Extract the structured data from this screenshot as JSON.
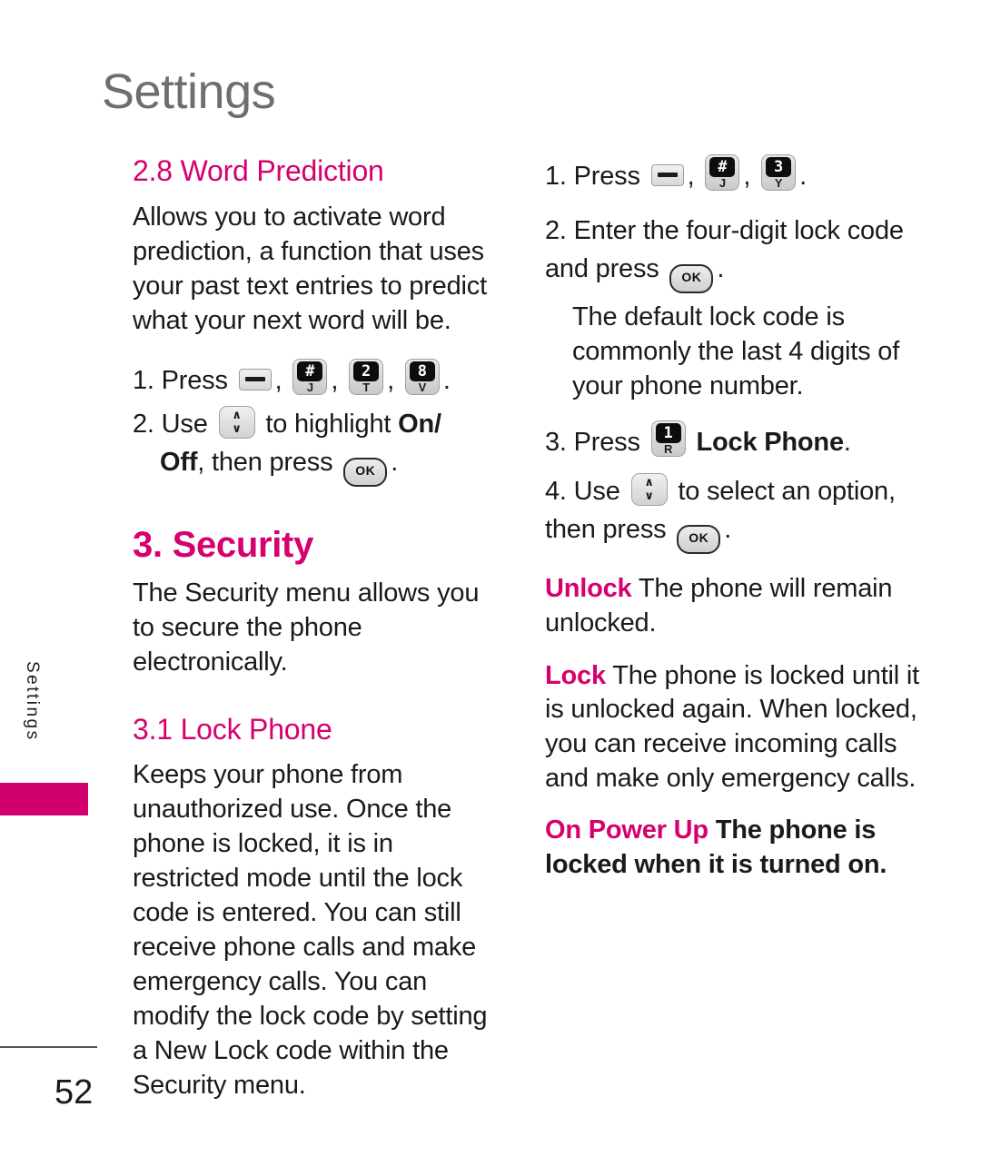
{
  "page": {
    "header_title": "Settings",
    "side_tab_label": "Settings",
    "page_number": "52"
  },
  "colors": {
    "accent_magenta": "#D6006E",
    "tab_magenta": "#D0006F",
    "header_gray": "#6E6E6E",
    "body_black": "#1A1A1A"
  },
  "keys": {
    "menu": {
      "name": "menu-soft-key",
      "label": ""
    },
    "hash_j": {
      "name": "key-hash-j",
      "digit": "#",
      "letter": "J"
    },
    "two_t": {
      "name": "key-2-t",
      "digit": "2",
      "letter": "T"
    },
    "eight_v": {
      "name": "key-8-v",
      "digit": "8",
      "letter": "V"
    },
    "three_y": {
      "name": "key-3-y",
      "digit": "3",
      "letter": "Y"
    },
    "one_r": {
      "name": "key-1-r",
      "digit": "1",
      "letter": "R"
    },
    "nav": {
      "name": "nav-up-down-key",
      "up": "∧",
      "down": "∨"
    },
    "ok": {
      "name": "ok-key",
      "label": "OK"
    }
  },
  "left_column": {
    "section_word_prediction": {
      "heading": "2.8 Word Prediction",
      "body": "Allows you to activate word prediction, a function that uses your past text entries to predict what your next word will be.",
      "steps": [
        {
          "number": "1.",
          "lead": "Press",
          "trail": "."
        },
        {
          "number": "2.",
          "lead": "Use",
          "mid": "to highlight",
          "bold1": "On/",
          "bold2": "Off",
          "mid2": ", then press",
          "trail": "."
        }
      ]
    },
    "section_security": {
      "heading": "3. Security",
      "body": "The Security menu allows you to secure the phone electronically."
    },
    "section_lock_phone": {
      "heading": "3.1 Lock Phone",
      "body": "Keeps your phone from unauthorized use. Once the phone is locked, it is in restricted mode until the lock code is entered. You can still receive phone calls and make emergency calls. You can modify the lock code by setting a New Lock code within the Security menu."
    }
  },
  "right_column": {
    "steps": [
      {
        "number": "1.",
        "lead": "Press",
        "trail": "."
      },
      {
        "number": "2.",
        "lead": "Enter the four-digit lock code and press",
        "trail": ".",
        "note": "The default lock code is commonly the last 4 digits of your phone number."
      },
      {
        "number": "3.",
        "lead": "Press",
        "bold": "Lock Phone",
        "trail": "."
      },
      {
        "number": "4.",
        "lead": "Use",
        "mid": "to select an option, then press",
        "trail": "."
      }
    ],
    "options": [
      {
        "term": "Unlock",
        "description": "The phone will remain unlocked."
      },
      {
        "term": "Lock",
        "description": "The phone is locked until it is unlocked again. When locked, you can receive incoming calls and make only emergency calls."
      },
      {
        "term": "On Power Up",
        "description": "The phone is locked when it is turned on."
      }
    ]
  }
}
